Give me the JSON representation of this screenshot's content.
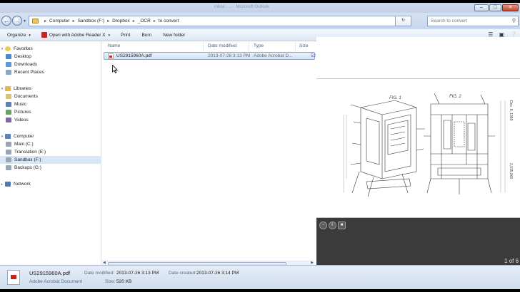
{
  "window": {
    "title": "Inbox - ... - Microsoft Outlook",
    "controls": {
      "minimize": "–",
      "maximize": "□",
      "close": "✕"
    }
  },
  "address": {
    "segments": [
      "Computer",
      "Sandbox (F:)",
      "Dropbox",
      "_OCR",
      "to convert"
    ],
    "search_placeholder": "Search to convert"
  },
  "toolbar": {
    "organize": "Organize",
    "open_with": "Open with Adobe Reader X",
    "print": "Print",
    "burn": "Burn",
    "new_folder": "New folder"
  },
  "nav": {
    "favorites": "Favorites",
    "desktop": "Desktop",
    "downloads": "Downloads",
    "recent_places": "Recent Places",
    "libraries": "Libraries",
    "documents": "Documents",
    "music": "Music",
    "pictures": "Pictures",
    "videos": "Videos",
    "computer": "Computer",
    "main_c": "Main (C:)",
    "translation_e": "Translation (E:)",
    "sandbox_f": "Sandbox (F:)",
    "backups_g": "Backups (G:)",
    "network": "Network"
  },
  "columns": {
    "name": "Name",
    "date_modified": "Date modified",
    "type": "Type",
    "size": "Size"
  },
  "files": [
    {
      "name": "US2915960A.pdf",
      "date_modified": "2013-07-26 3:13 PM",
      "type": "Adobe Acrobat D...",
      "size": "52"
    }
  ],
  "preview": {
    "page_count": "1 of 6",
    "fig1": "FIG. 1",
    "fig2": "FIG. 2",
    "side_date": "Dec. 8, 1959",
    "side_number": "2,915,960"
  },
  "details": {
    "file_name": "US2915960A.pdf",
    "file_type": "Adobe Acrobat Document",
    "date_modified_label": "Date modified:",
    "date_modified": "2013-07-26 3:13 PM",
    "date_created_label": "Date created:",
    "date_created": "2013-07-26 3:14 PM",
    "size_label": "Size:",
    "size": "520 KB"
  },
  "colors": {
    "accent": "#3a6ea5",
    "selection": "#cfe3f8",
    "preview_bg": "#3b3b3b",
    "pdf_red": "#c8231e"
  }
}
